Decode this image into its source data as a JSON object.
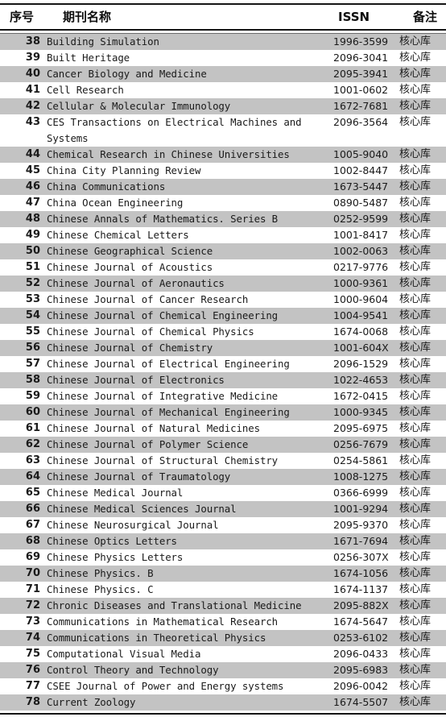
{
  "table": {
    "headers": {
      "seq": "序号",
      "name": "期刊名称",
      "issn": "ISSN",
      "note": "备注"
    },
    "colors": {
      "shaded_row": "#c3c3c3",
      "plain_row": "#ffffff",
      "rule": "#151515",
      "text": "#1a1a1a"
    },
    "rows": [
      {
        "seq": "38",
        "name": "Building Simulation",
        "issn": "1996-3599",
        "note": "核心库",
        "shaded": true,
        "lines": 1
      },
      {
        "seq": "39",
        "name": "Built Heritage",
        "issn": "2096-3041",
        "note": "核心库",
        "shaded": false,
        "lines": 1
      },
      {
        "seq": "40",
        "name": "Cancer Biology and Medicine",
        "issn": "2095-3941",
        "note": "核心库",
        "shaded": true,
        "lines": 1
      },
      {
        "seq": "41",
        "name": "Cell Research",
        "issn": "1001-0602",
        "note": "核心库",
        "shaded": false,
        "lines": 1
      },
      {
        "seq": "42",
        "name": "Cellular & Molecular Immunology",
        "issn": "1672-7681",
        "note": "核心库",
        "shaded": true,
        "lines": 1
      },
      {
        "seq": "43",
        "name": "CES Transactions on Electrical Machines and",
        "name_line2": "Systems",
        "issn": "2096-3564",
        "note": "核心库",
        "shaded": false,
        "lines": 2
      },
      {
        "seq": "44",
        "name": "Chemical Research in Chinese Universities",
        "issn": "1005-9040",
        "note": "核心库",
        "shaded": true,
        "lines": 1
      },
      {
        "seq": "45",
        "name": "China City Planning Review",
        "issn": "1002-8447",
        "note": "核心库",
        "shaded": false,
        "lines": 1
      },
      {
        "seq": "46",
        "name": "China Communications",
        "issn": "1673-5447",
        "note": "核心库",
        "shaded": true,
        "lines": 1
      },
      {
        "seq": "47",
        "name": "China Ocean Engineering",
        "issn": "0890-5487",
        "note": "核心库",
        "shaded": false,
        "lines": 1
      },
      {
        "seq": "48",
        "name": "Chinese Annals of Mathematics. Series B",
        "issn": "0252-9599",
        "note": "核心库",
        "shaded": true,
        "lines": 1
      },
      {
        "seq": "49",
        "name": "Chinese Chemical Letters",
        "issn": "1001-8417",
        "note": "核心库",
        "shaded": false,
        "lines": 1
      },
      {
        "seq": "50",
        "name": "Chinese Geographical Science",
        "issn": "1002-0063",
        "note": "核心库",
        "shaded": true,
        "lines": 1
      },
      {
        "seq": "51",
        "name": "Chinese Journal of Acoustics",
        "issn": "0217-9776",
        "note": "核心库",
        "shaded": false,
        "lines": 1
      },
      {
        "seq": "52",
        "name": "Chinese Journal of Aeronautics",
        "issn": "1000-9361",
        "note": "核心库",
        "shaded": true,
        "lines": 1
      },
      {
        "seq": "53",
        "name": "Chinese Journal of Cancer Research",
        "issn": "1000-9604",
        "note": "核心库",
        "shaded": false,
        "lines": 1
      },
      {
        "seq": "54",
        "name": "Chinese Journal of Chemical Engineering",
        "issn": "1004-9541",
        "note": "核心库",
        "shaded": true,
        "lines": 1
      },
      {
        "seq": "55",
        "name": "Chinese Journal of Chemical Physics",
        "issn": "1674-0068",
        "note": "核心库",
        "shaded": false,
        "lines": 1
      },
      {
        "seq": "56",
        "name": "Chinese Journal of Chemistry",
        "issn": "1001-604X",
        "note": "核心库",
        "shaded": true,
        "lines": 1
      },
      {
        "seq": "57",
        "name": "Chinese Journal of Electrical Engineering",
        "issn": "2096-1529",
        "note": "核心库",
        "shaded": false,
        "lines": 1
      },
      {
        "seq": "58",
        "name": "Chinese Journal of Electronics",
        "issn": "1022-4653",
        "note": "核心库",
        "shaded": true,
        "lines": 1
      },
      {
        "seq": "59",
        "name": "Chinese Journal of Integrative Medicine",
        "issn": "1672-0415",
        "note": "核心库",
        "shaded": false,
        "lines": 1
      },
      {
        "seq": "60",
        "name": "Chinese Journal of Mechanical Engineering",
        "issn": "1000-9345",
        "note": "核心库",
        "shaded": true,
        "lines": 1
      },
      {
        "seq": "61",
        "name": "Chinese Journal of Natural Medicines",
        "issn": "2095-6975",
        "note": "核心库",
        "shaded": false,
        "lines": 1
      },
      {
        "seq": "62",
        "name": "Chinese Journal of Polymer Science",
        "issn": "0256-7679",
        "note": "核心库",
        "shaded": true,
        "lines": 1
      },
      {
        "seq": "63",
        "name": "Chinese Journal of Structural Chemistry",
        "issn": "0254-5861",
        "note": "核心库",
        "shaded": false,
        "lines": 1
      },
      {
        "seq": "64",
        "name": "Chinese Journal of Traumatology",
        "issn": "1008-1275",
        "note": "核心库",
        "shaded": true,
        "lines": 1
      },
      {
        "seq": "65",
        "name": "Chinese Medical Journal",
        "issn": "0366-6999",
        "note": "核心库",
        "shaded": false,
        "lines": 1
      },
      {
        "seq": "66",
        "name": "Chinese Medical Sciences Journal",
        "issn": "1001-9294",
        "note": "核心库",
        "shaded": true,
        "lines": 1
      },
      {
        "seq": "67",
        "name": "Chinese Neurosurgical Journal",
        "issn": "2095-9370",
        "note": "核心库",
        "shaded": false,
        "lines": 1
      },
      {
        "seq": "68",
        "name": "Chinese Optics Letters",
        "issn": "1671-7694",
        "note": "核心库",
        "shaded": true,
        "lines": 1
      },
      {
        "seq": "69",
        "name": "Chinese Physics Letters",
        "issn": "0256-307X",
        "note": "核心库",
        "shaded": false,
        "lines": 1
      },
      {
        "seq": "70",
        "name": "Chinese Physics. B",
        "issn": "1674-1056",
        "note": "核心库",
        "shaded": true,
        "lines": 1
      },
      {
        "seq": "71",
        "name": "Chinese Physics. C",
        "issn": "1674-1137",
        "note": "核心库",
        "shaded": false,
        "lines": 1
      },
      {
        "seq": "72",
        "name": "Chronic Diseases and Translational Medicine",
        "issn": "2095-882X",
        "note": "核心库",
        "shaded": true,
        "lines": 1
      },
      {
        "seq": "73",
        "name": "Communications in Mathematical Research",
        "issn": "1674-5647",
        "note": "核心库",
        "shaded": false,
        "lines": 1
      },
      {
        "seq": "74",
        "name": "Communications in Theoretical Physics",
        "issn": "0253-6102",
        "note": "核心库",
        "shaded": true,
        "lines": 1
      },
      {
        "seq": "75",
        "name": "Computational Visual Media",
        "issn": "2096-0433",
        "note": "核心库",
        "shaded": false,
        "lines": 1
      },
      {
        "seq": "76",
        "name": "Control Theory and Technology",
        "issn": "2095-6983",
        "note": "核心库",
        "shaded": true,
        "lines": 1
      },
      {
        "seq": "77",
        "name": "CSEE Journal of Power and Energy systems",
        "issn": "2096-0042",
        "note": "核心库",
        "shaded": false,
        "lines": 1
      },
      {
        "seq": "78",
        "name": "Current Zoology",
        "issn": "1674-5507",
        "note": "核心库",
        "shaded": true,
        "lines": 1
      }
    ]
  }
}
